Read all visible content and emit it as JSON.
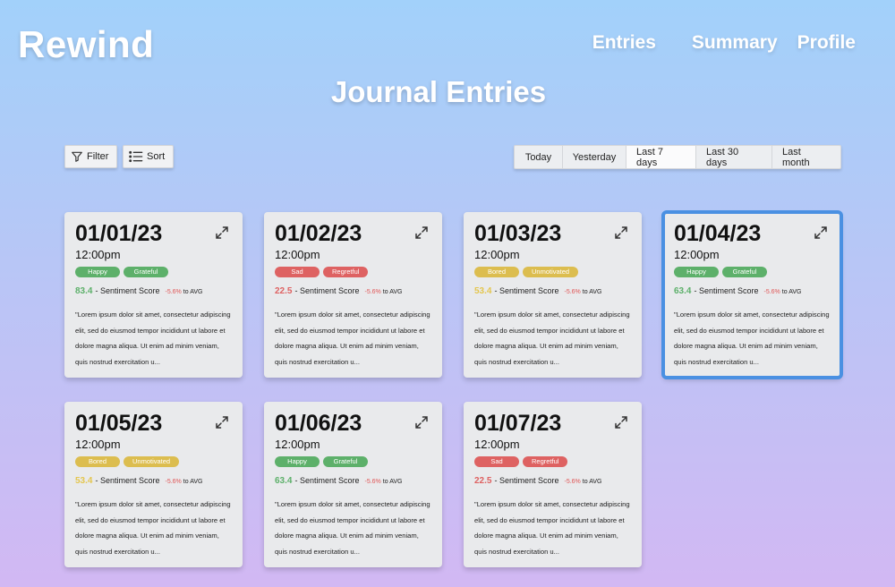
{
  "app": {
    "title": "Rewind"
  },
  "nav": {
    "items": [
      "Entries",
      "Summary",
      "Profile"
    ]
  },
  "page": {
    "title": "Journal Entries"
  },
  "toolbar": {
    "filter_label": "Filter",
    "sort_label": "Sort"
  },
  "range": {
    "options": [
      "Today",
      "Yesterday",
      "Last 7 days",
      "Last 30 days",
      "Last month"
    ],
    "selected": "Last 7 days"
  },
  "colors": {
    "tag_green": "#5db06a",
    "tag_red": "#de6262",
    "tag_yellow": "#dcbd4f",
    "score_green": "#5db06a",
    "score_red": "#de6262",
    "score_yellow": "#e4c64f",
    "delta_red": "#e05757",
    "selected_border": "#4a90e2"
  },
  "entries": [
    {
      "date": "01/01/23",
      "time": "12:00pm",
      "tags": [
        {
          "label": "Happy",
          "color": "green"
        },
        {
          "label": "Grateful",
          "color": "green"
        }
      ],
      "score": "83.4",
      "score_color": "green",
      "score_label": "- Sentiment Score",
      "delta": "-5.6%",
      "delta_suffix": "to AVG",
      "excerpt": "\"Lorem ipsum dolor sit amet, consectetur adipiscing elit, sed do eiusmod tempor incididunt ut labore et dolore magna aliqua. Ut enim ad minim veniam, quis nostrud exercitation u...",
      "selected": false
    },
    {
      "date": "01/02/23",
      "time": "12:00pm",
      "tags": [
        {
          "label": "Sad",
          "color": "red"
        },
        {
          "label": "Regretful",
          "color": "red"
        }
      ],
      "score": "22.5",
      "score_color": "red",
      "score_label": "- Sentiment Score",
      "delta": "-5.6%",
      "delta_suffix": "to AVG",
      "excerpt": "\"Lorem ipsum dolor sit amet, consectetur adipiscing elit, sed do eiusmod tempor incididunt ut labore et dolore magna aliqua. Ut enim ad minim veniam, quis nostrud exercitation u...",
      "selected": false
    },
    {
      "date": "01/03/23",
      "time": "12:00pm",
      "tags": [
        {
          "label": "Bored",
          "color": "yellow"
        },
        {
          "label": "Unmotivated",
          "color": "yellow"
        }
      ],
      "score": "53.4",
      "score_color": "yellow",
      "score_label": "- Sentiment Score",
      "delta": "-5.6%",
      "delta_suffix": "to AVG",
      "excerpt": "\"Lorem ipsum dolor sit amet, consectetur adipiscing elit, sed do eiusmod tempor incididunt ut labore et dolore magna aliqua. Ut enim ad minim veniam, quis nostrud exercitation u...",
      "selected": false
    },
    {
      "date": "01/04/23",
      "time": "12:00pm",
      "tags": [
        {
          "label": "Happy",
          "color": "green"
        },
        {
          "label": "Grateful",
          "color": "green"
        }
      ],
      "score": "63.4",
      "score_color": "green",
      "score_label": "- Sentiment Score",
      "delta": "-5.6%",
      "delta_suffix": "to AVG",
      "excerpt": "\"Lorem ipsum dolor sit amet, consectetur adipiscing elit, sed do eiusmod tempor incididunt ut labore et dolore magna aliqua. Ut enim ad minim veniam, quis nostrud exercitation u...",
      "selected": true
    },
    {
      "date": "01/05/23",
      "time": "12:00pm",
      "tags": [
        {
          "label": "Bored",
          "color": "yellow"
        },
        {
          "label": "Unmotivated",
          "color": "yellow"
        }
      ],
      "score": "53.4",
      "score_color": "yellow",
      "score_label": "- Sentiment Score",
      "delta": "-5.6%",
      "delta_suffix": "to AVG",
      "excerpt": "\"Lorem ipsum dolor sit amet, consectetur adipiscing elit, sed do eiusmod tempor incididunt ut labore et dolore magna aliqua. Ut enim ad minim veniam, quis nostrud exercitation u...",
      "selected": false
    },
    {
      "date": "01/06/23",
      "time": "12:00pm",
      "tags": [
        {
          "label": "Happy",
          "color": "green"
        },
        {
          "label": "Grateful",
          "color": "green"
        }
      ],
      "score": "63.4",
      "score_color": "green",
      "score_label": "- Sentiment Score",
      "delta": "-5.6%",
      "delta_suffix": "to AVG",
      "excerpt": "\"Lorem ipsum dolor sit amet, consectetur adipiscing elit, sed do eiusmod tempor incididunt ut labore et dolore magna aliqua. Ut enim ad minim veniam, quis nostrud exercitation u...",
      "selected": false
    },
    {
      "date": "01/07/23",
      "time": "12:00pm",
      "tags": [
        {
          "label": "Sad",
          "color": "red"
        },
        {
          "label": "Regretful",
          "color": "red"
        }
      ],
      "score": "22.5",
      "score_color": "red",
      "score_label": "- Sentiment Score",
      "delta": "-5.6%",
      "delta_suffix": "to AVG",
      "excerpt": "\"Lorem ipsum dolor sit amet, consectetur adipiscing elit, sed do eiusmod tempor incididunt ut labore et dolore magna aliqua. Ut enim ad minim veniam, quis nostrud exercitation u...",
      "selected": false
    }
  ]
}
